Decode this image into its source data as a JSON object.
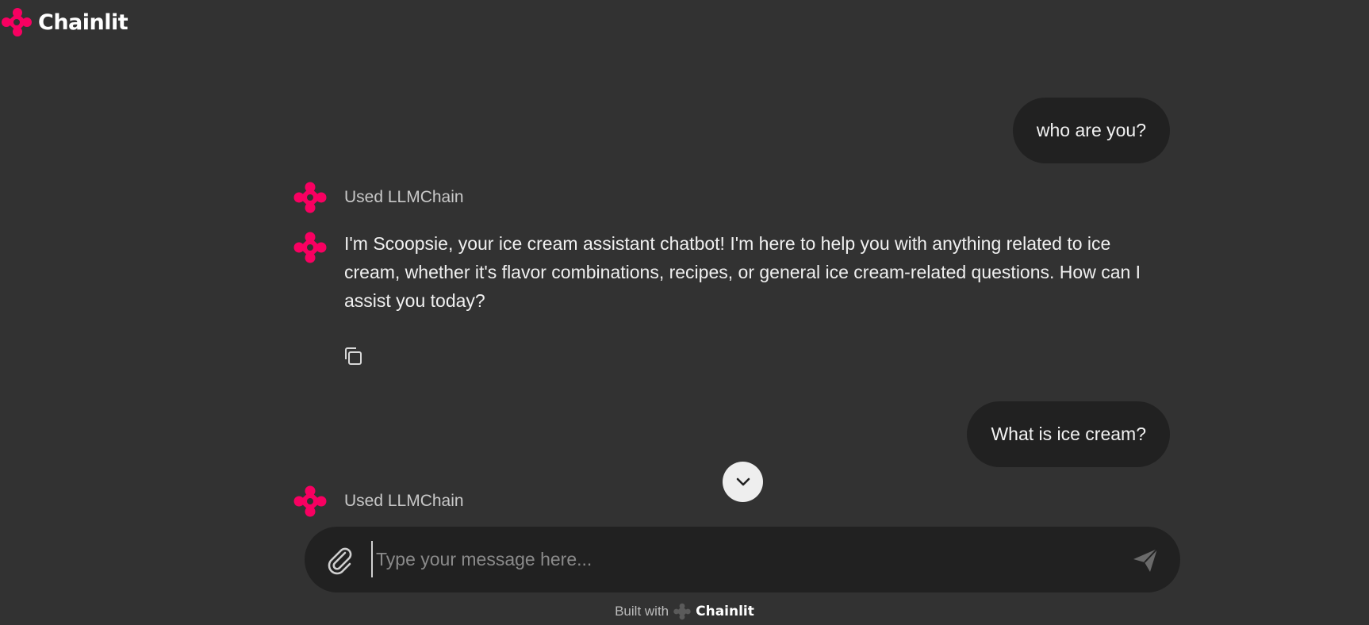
{
  "app": {
    "brand_name": "Chainlit",
    "accent_color": "#F80061",
    "background_color": "#323232"
  },
  "messages": [
    {
      "role": "user",
      "text": "who are you?"
    },
    {
      "role": "step",
      "label": "Used LLMChain"
    },
    {
      "role": "assistant",
      "text": "I'm Scoopsie, your ice cream assistant chatbot! I'm here to help you with anything related to ice cream, whether it's flavor combinations, recipes, or general ice cream-related questions. How can I assist you today?"
    },
    {
      "role": "user",
      "text": "What is ice cream?"
    },
    {
      "role": "step",
      "label": "Used LLMChain"
    }
  ],
  "icons": {
    "copy": "copy-icon",
    "scroll": "chevron-down-icon",
    "attach": "paperclip-icon",
    "send": "send-icon"
  },
  "composer": {
    "placeholder": "Type your message here...",
    "value": ""
  },
  "footer": {
    "built_with": "Built with",
    "brand": "Chainlit"
  }
}
